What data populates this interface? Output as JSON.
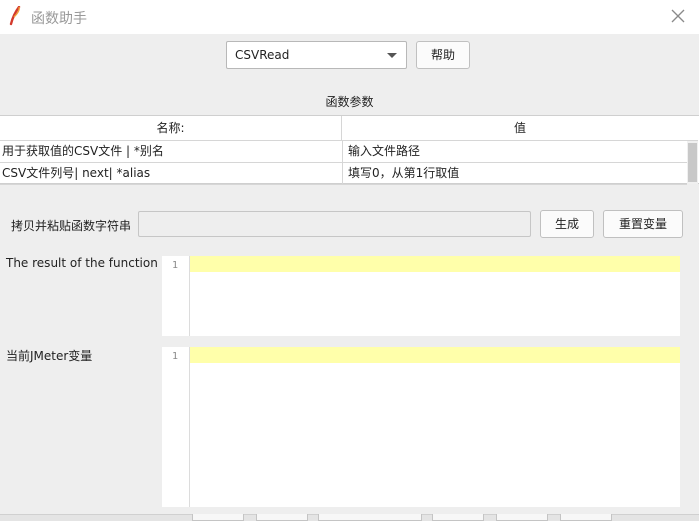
{
  "window": {
    "title": "函数助手",
    "app_icon": "feather-icon",
    "close_icon": "close-icon"
  },
  "function_selector": {
    "selected": "CSVRead",
    "help_label": "帮助"
  },
  "params": {
    "section_label": "函数参数",
    "columns": {
      "name": "名称:",
      "value": "值"
    },
    "rows": [
      {
        "name": "用于获取值的CSV文件 | *别名",
        "value": "输入文件路径"
      },
      {
        "name": "CSV文件列号| next| *alias",
        "value": "填写0，从第1行取值"
      }
    ]
  },
  "copy": {
    "label": "拷贝并粘贴函数字符串",
    "value": "",
    "generate_label": "生成",
    "reset_label": "重置变量"
  },
  "result": {
    "label": "The result of the function is",
    "line_number": "1"
  },
  "jmeter_vars": {
    "label": "当前JMeter变量",
    "line_number": "1"
  },
  "colors": {
    "current_line_highlight": "#ffffaa",
    "title_text": "#999999"
  }
}
